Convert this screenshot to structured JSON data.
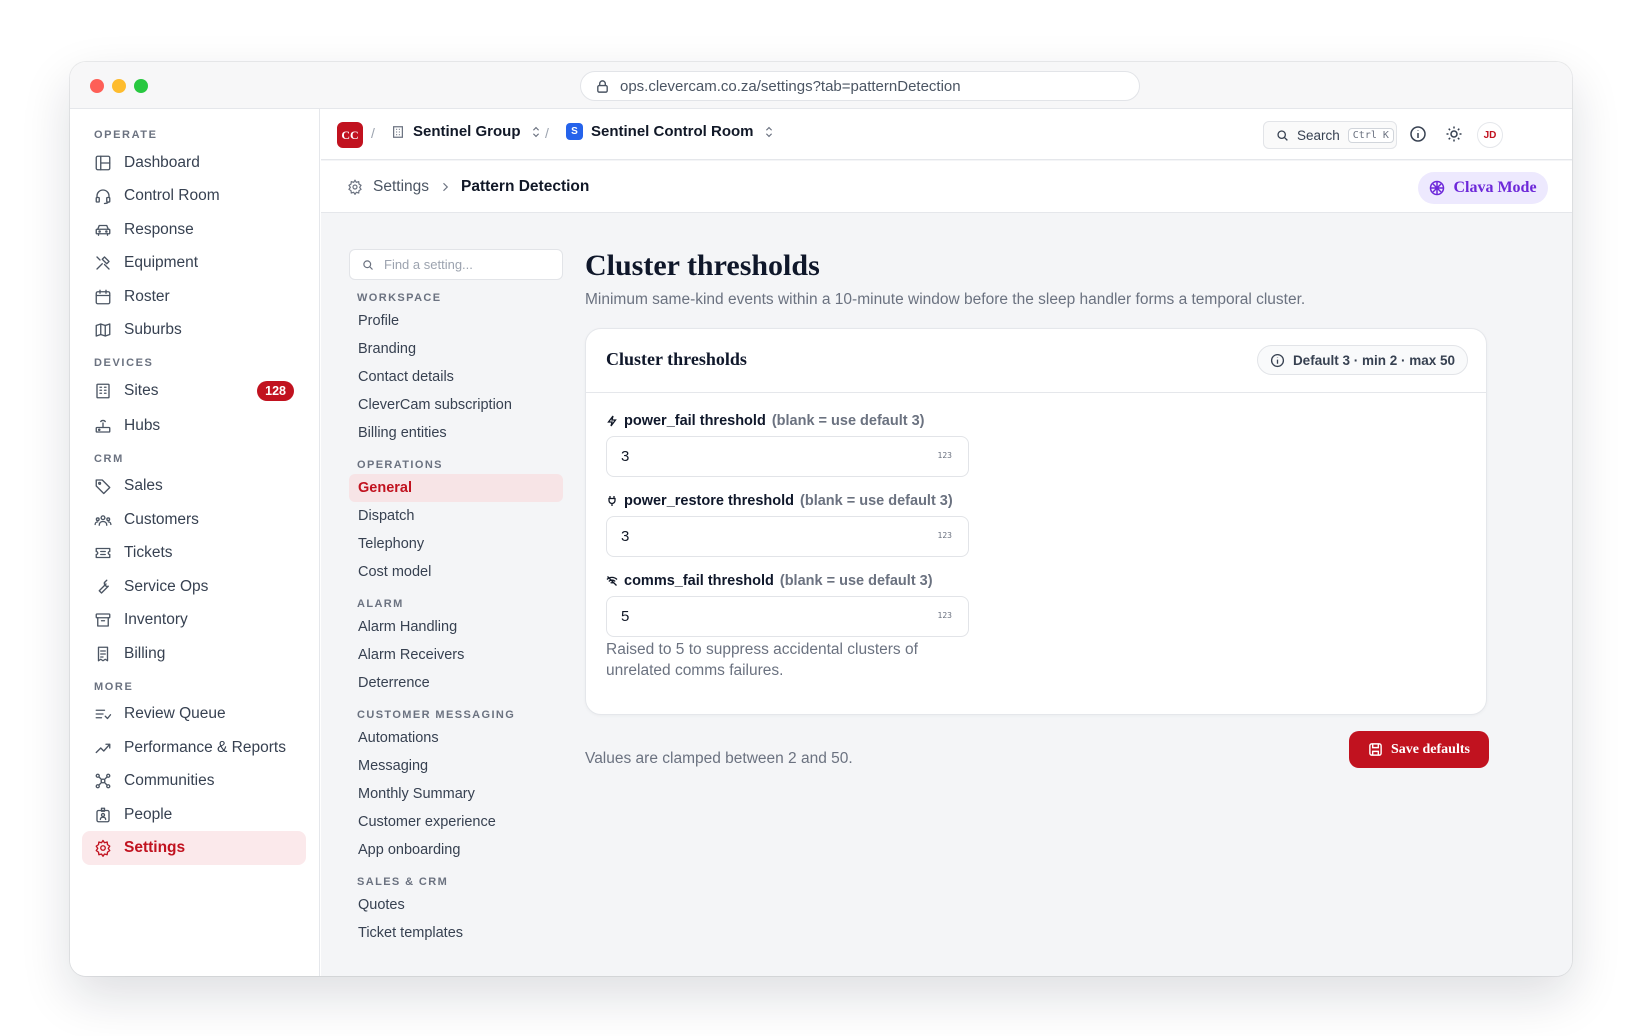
{
  "browser": {
    "url": "ops.clevercam.co.za/settings?tab=patternDetection"
  },
  "sidebar": {
    "sections": [
      {
        "label": "OPERATE"
      },
      {
        "label": "DEVICES"
      },
      {
        "label": "CRM"
      },
      {
        "label": "MORE"
      }
    ],
    "items": [
      {
        "label": "Dashboard",
        "icon": "layout-icon"
      },
      {
        "label": "Control Room",
        "icon": "headset-icon"
      },
      {
        "label": "Response",
        "icon": "car-icon"
      },
      {
        "label": "Equipment",
        "icon": "tools-icon"
      },
      {
        "label": "Roster",
        "icon": "calendar-icon"
      },
      {
        "label": "Suburbs",
        "icon": "map-icon"
      },
      {
        "label": "Sites",
        "icon": "building-icon",
        "badge": "128"
      },
      {
        "label": "Hubs",
        "icon": "router-icon"
      },
      {
        "label": "Sales",
        "icon": "tag-icon"
      },
      {
        "label": "Customers",
        "icon": "users-icon"
      },
      {
        "label": "Tickets",
        "icon": "ticket-icon"
      },
      {
        "label": "Service Ops",
        "icon": "wrench-icon"
      },
      {
        "label": "Inventory",
        "icon": "archive-icon"
      },
      {
        "label": "Billing",
        "icon": "receipt-icon"
      },
      {
        "label": "Review Queue",
        "icon": "list-check-icon"
      },
      {
        "label": "Performance & Reports",
        "icon": "trend-icon"
      },
      {
        "label": "Communities",
        "icon": "network-icon"
      },
      {
        "label": "People",
        "icon": "id-badge-icon"
      },
      {
        "label": "Settings",
        "icon": "gear-icon",
        "active": true
      }
    ]
  },
  "topbar": {
    "logo": "CC",
    "org": "Sentinel Group",
    "room_logo": "S",
    "room": "Sentinel Control Room",
    "search_label": "Search",
    "search_shortcut": "Ctrl K",
    "avatar": "JD"
  },
  "subbar": {
    "crumb_root": "Settings",
    "crumb_current": "Pattern Detection",
    "mode_button": "Clava Mode"
  },
  "settings_nav": {
    "search_placeholder": "Find a setting...",
    "groups": [
      {
        "label": "WORKSPACE",
        "items": [
          "Profile",
          "Branding",
          "Contact details",
          "CleverCam subscription",
          "Billing entities"
        ]
      },
      {
        "label": "OPERATIONS",
        "items": [
          "General",
          "Dispatch",
          "Telephony",
          "Cost model"
        ]
      },
      {
        "label": "ALARM",
        "items": [
          "Alarm Handling",
          "Alarm Receivers",
          "Deterrence"
        ]
      },
      {
        "label": "CUSTOMER MESSAGING",
        "items": [
          "Automations",
          "Messaging",
          "Monthly Summary",
          "Customer experience",
          "App onboarding"
        ]
      },
      {
        "label": "SALES & CRM",
        "items": [
          "Quotes",
          "Ticket templates"
        ]
      }
    ],
    "active": "General"
  },
  "content": {
    "title": "Cluster thresholds",
    "description": "Minimum same-kind events within a 10-minute window before the sleep handler forms a temporal cluster.",
    "card_title": "Cluster thresholds",
    "defaults_pill": "Default 3 · min 2 · max 50",
    "fields": [
      {
        "name": "power_fail threshold",
        "hint": "(blank = use default 3)",
        "value": "3",
        "icon": "bolt-icon"
      },
      {
        "name": "power_restore threshold",
        "hint": "(blank = use default 3)",
        "value": "3",
        "icon": "plug-icon"
      },
      {
        "name": "comms_fail threshold",
        "hint": "(blank = use default 3)",
        "value": "5",
        "icon": "wifi-off-icon"
      }
    ],
    "number_glyph": "123",
    "help_text": "Raised to 5 to suppress accidental clusters of unrelated comms failures.",
    "clamp_note": "Values are clamped between 2 and 50.",
    "save_button": "Save defaults"
  },
  "colors": {
    "brand": "#c1121f",
    "clava": "#6d28d9",
    "active_bg": "#fbe9eb"
  }
}
